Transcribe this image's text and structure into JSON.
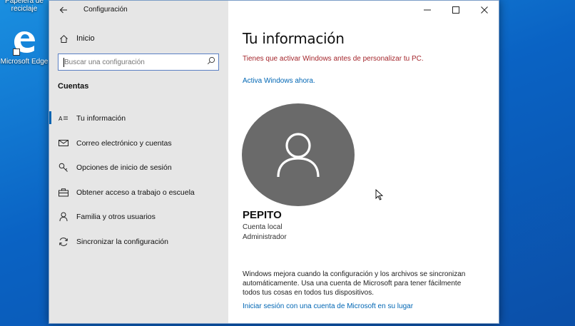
{
  "desktop": {
    "recycle_bin_label": "Papelera de reciclaje",
    "edge_label": "Microsoft Edge",
    "edge_color": "#1976d2"
  },
  "window": {
    "title": "Configuración",
    "back_icon": "arrow-left-icon",
    "controls": [
      "minimize-icon",
      "maximize-icon",
      "close-icon"
    ]
  },
  "sidebar": {
    "home_label": "Inicio",
    "search_placeholder": "Buscar una configuración",
    "section_title": "Cuentas",
    "items": [
      {
        "label": "Tu información",
        "icon": "user-card-icon",
        "active": true
      },
      {
        "label": "Correo electrónico y cuentas",
        "icon": "mail-icon",
        "active": false
      },
      {
        "label": "Opciones de inicio de sesión",
        "icon": "key-icon",
        "active": false
      },
      {
        "label": "Obtener acceso a trabajo o escuela",
        "icon": "briefcase-icon",
        "active": false
      },
      {
        "label": "Familia y otros usuarios",
        "icon": "person-icon",
        "active": false
      },
      {
        "label": "Sincronizar la configuración",
        "icon": "sync-icon",
        "active": false
      }
    ]
  },
  "main": {
    "title": "Tu información",
    "warning": "Tienes que activar Windows antes de personalizar tu PC.",
    "warning_color": "#a4262c",
    "activate_link": "Activa Windows ahora.",
    "link_color": "#0066b4",
    "user": {
      "name": "PEPITO",
      "account_type": "Cuenta local",
      "role": "Administrador"
    },
    "sync_text": "Windows mejora cuando la configuración y los archivos se sincronizan automáticamente. Usa una cuenta de Microsoft para tener fácilmente todos tus cosas en todos tus dispositivos.",
    "ms_signin_link": "Iniciar sesión con una cuenta de Microsoft en su lugar"
  }
}
